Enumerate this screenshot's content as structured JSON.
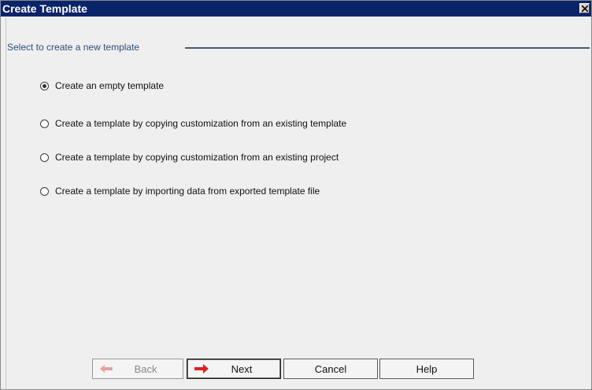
{
  "window": {
    "title": "Create Template"
  },
  "group": {
    "label": "Select to create a new template"
  },
  "options": [
    {
      "label": "Create an empty template",
      "selected": true
    },
    {
      "label": "Create a template by copying customization from an existing template",
      "selected": false
    },
    {
      "label": "Create a template by copying customization from an existing project",
      "selected": false
    },
    {
      "label": "Create a template by importing data from exported template file",
      "selected": false
    }
  ],
  "buttons": {
    "back": "Back",
    "next": "Next",
    "cancel": "Cancel",
    "help": "Help"
  },
  "colors": {
    "titlebar": "#0a246a",
    "group_label": "#2e4d7b",
    "arrow_red": "#e02020"
  },
  "icons": {
    "close": "close-icon",
    "back_arrow": "back-arrow-icon",
    "next_arrow": "next-arrow-icon"
  }
}
